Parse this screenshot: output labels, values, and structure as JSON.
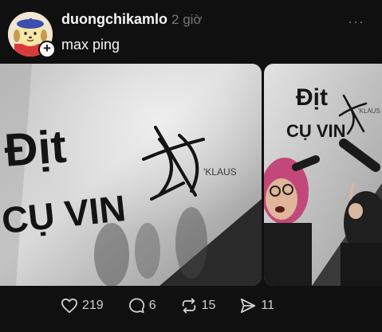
{
  "post": {
    "username": "duongchikamlo",
    "time": "2 giờ",
    "caption": "max ping",
    "more_label": "···",
    "add_badge": "+"
  },
  "media": {
    "image1": {
      "graffiti_line1": "Địt",
      "graffiti_line2": "CỤ VIN",
      "graffiti_small": "'KLAUS"
    },
    "image2": {
      "graffiti_line1": "Địt",
      "graffiti_line2": "CỤ VIN",
      "graffiti_small": "'KLAUS"
    }
  },
  "actions": {
    "likes": "219",
    "comments": "6",
    "reposts": "15",
    "shares": "11"
  },
  "icons": [
    "avatar",
    "more-icon",
    "heart-icon",
    "comment-icon",
    "repost-icon",
    "share-icon"
  ],
  "colors": {
    "background": "#101010",
    "text": "#f3f5f7",
    "muted": "#777777"
  }
}
